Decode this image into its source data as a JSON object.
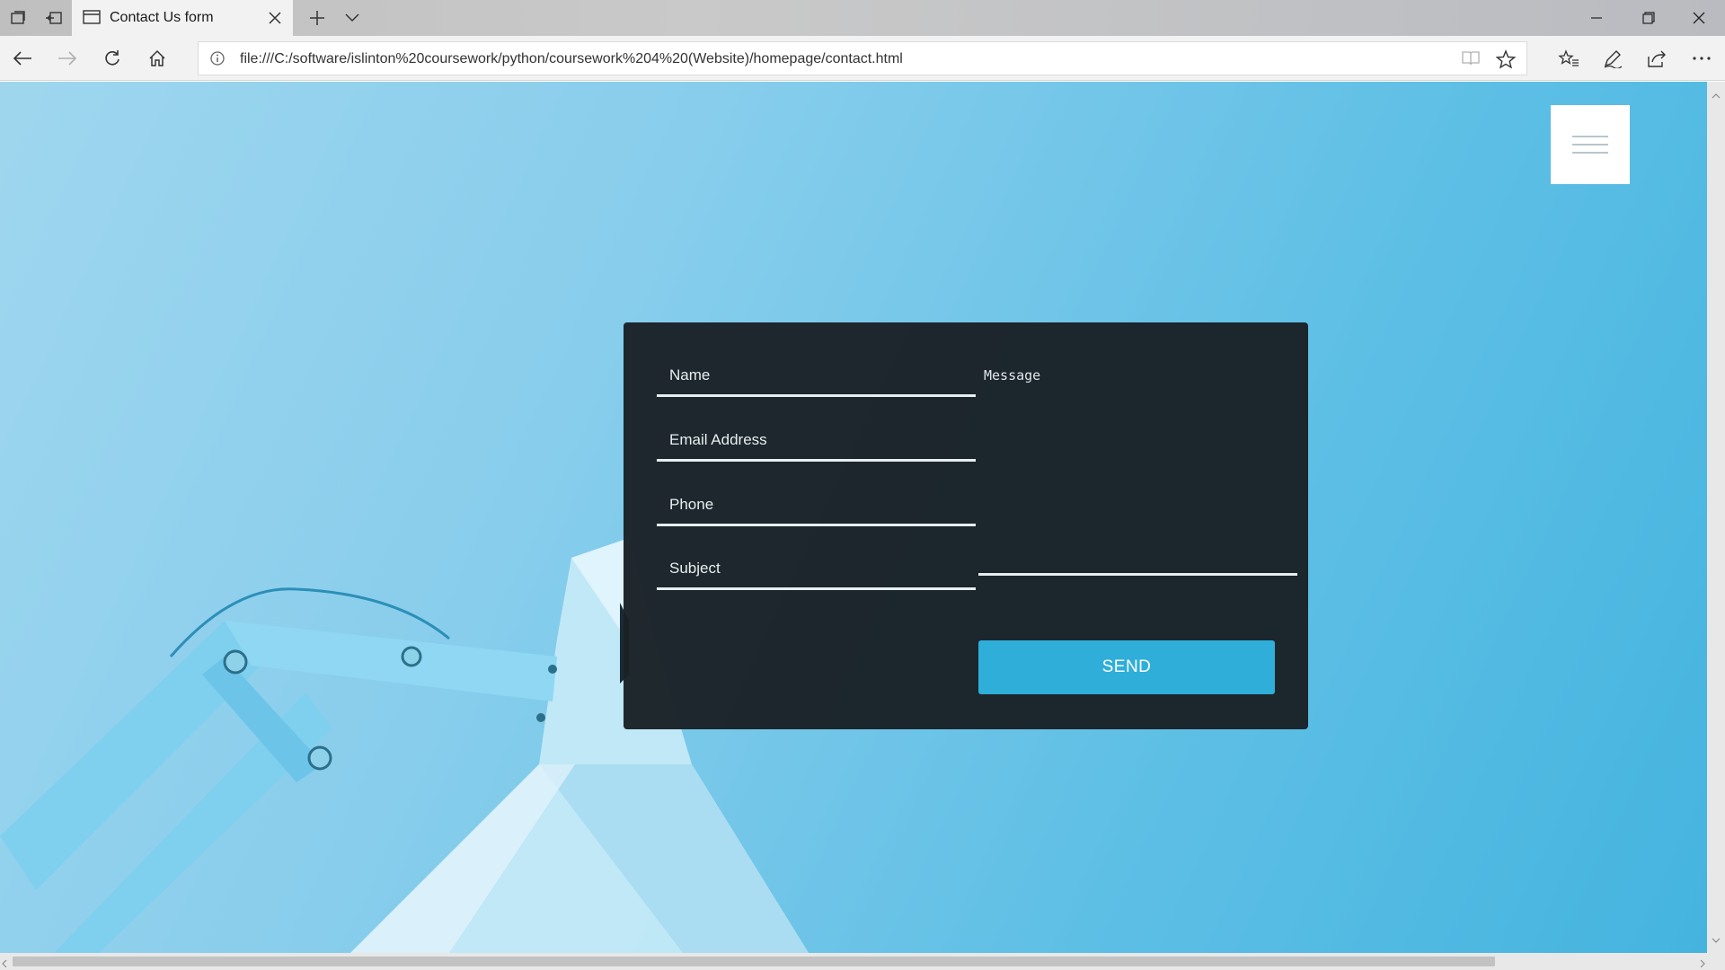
{
  "browser": {
    "tab_title": "Contact Us form",
    "url": "file:///C:/software/islinton%20coursework/python/coursework%204%20(Website)/homepage/contact.html",
    "icons": {
      "tab_list": "tab-list-icon",
      "set_aside": "set-aside-tabs-icon",
      "page": "page-icon",
      "close_tab": "close-icon",
      "new_tab": "plus-icon",
      "tab_preview": "chevron-down-icon",
      "minimize": "minimize-icon",
      "restore": "restore-icon",
      "close_window": "close-icon",
      "back": "back-arrow-icon",
      "forward": "forward-arrow-icon",
      "refresh": "refresh-icon",
      "home": "home-icon",
      "site_info": "info-icon",
      "reading_view": "reading-view-icon",
      "favorite": "star-icon",
      "favorites_hub": "favorites-hub-icon",
      "notes": "pen-icon",
      "share": "share-icon",
      "more": "more-icon"
    }
  },
  "page": {
    "menu_icon": "hamburger-icon",
    "form": {
      "name_placeholder": "Name",
      "email_placeholder": "Email Address",
      "phone_placeholder": "Phone",
      "subject_placeholder": "Subject",
      "message_placeholder": "Message",
      "send_label": "SEND"
    },
    "colors": {
      "form_bg": "#1a2126",
      "accent": "#2eaed8",
      "background": "#5ebfe5"
    }
  }
}
